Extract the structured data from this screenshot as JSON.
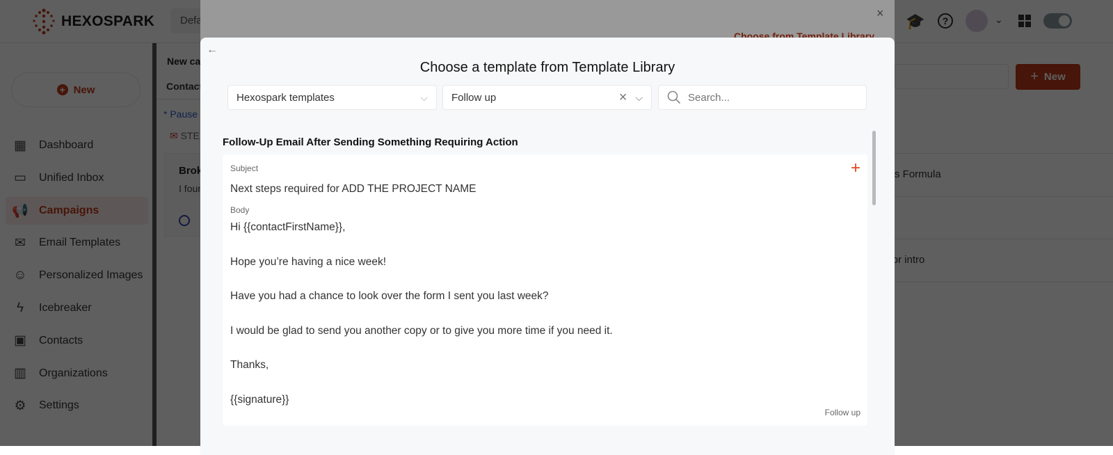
{
  "app": {
    "brand": "HEXOSPARK",
    "workspace_partial": "Defa"
  },
  "sidebar": {
    "new_label": "New",
    "items": [
      {
        "label": "Dashboard",
        "icon": "dashboard-icon"
      },
      {
        "label": "Unified Inbox",
        "icon": "inbox-icon"
      },
      {
        "label": "Campaigns",
        "icon": "megaphone-icon",
        "active": true
      },
      {
        "label": "Email Templates",
        "icon": "email-template-icon"
      },
      {
        "label": "Personalized Images",
        "icon": "personalized-image-icon"
      },
      {
        "label": "Icebreaker",
        "icon": "lightning-icon"
      },
      {
        "label": "Contacts",
        "icon": "contact-icon"
      },
      {
        "label": "Organizations",
        "icon": "building-icon"
      },
      {
        "label": "Settings",
        "icon": "gear-icon"
      }
    ]
  },
  "background": {
    "campaign_title_partial": "New ca",
    "contacts_partial": "Contact",
    "paused_partial": "* Pause",
    "step_partial": "STE",
    "card_title_partial": "Brok",
    "card_text_partial": "I foun",
    "new_button": "New",
    "rows": [
      "efits Formula",
      "g for intro"
    ]
  },
  "colors": {
    "accent": "#e0461f",
    "brand_dark": "#c0391b"
  },
  "outer_modal": {
    "link": "Choose from Template Library",
    "close": "×"
  },
  "modal": {
    "back": "←",
    "title": "Choose a template from Template Library",
    "source_select": "Hexospark templates",
    "category_select": "Follow up",
    "search_placeholder": "Search...",
    "template": {
      "name": "Follow-Up Email After Sending Something Requiring Action",
      "subject_label": "Subject",
      "subject": "Next steps required for ADD THE PROJECT NAME",
      "body_label": "Body",
      "body_lines": [
        "Hi {{contactFirstName}},",
        "",
        "Hope you’re having a nice week!",
        "",
        "Have you had a chance to look over the form I sent you last week?",
        "",
        "I would be glad to send you another copy or to give you more time if you need it.",
        "",
        "Thanks,",
        "",
        "{{signature}}"
      ],
      "tag": "Follow up"
    }
  }
}
